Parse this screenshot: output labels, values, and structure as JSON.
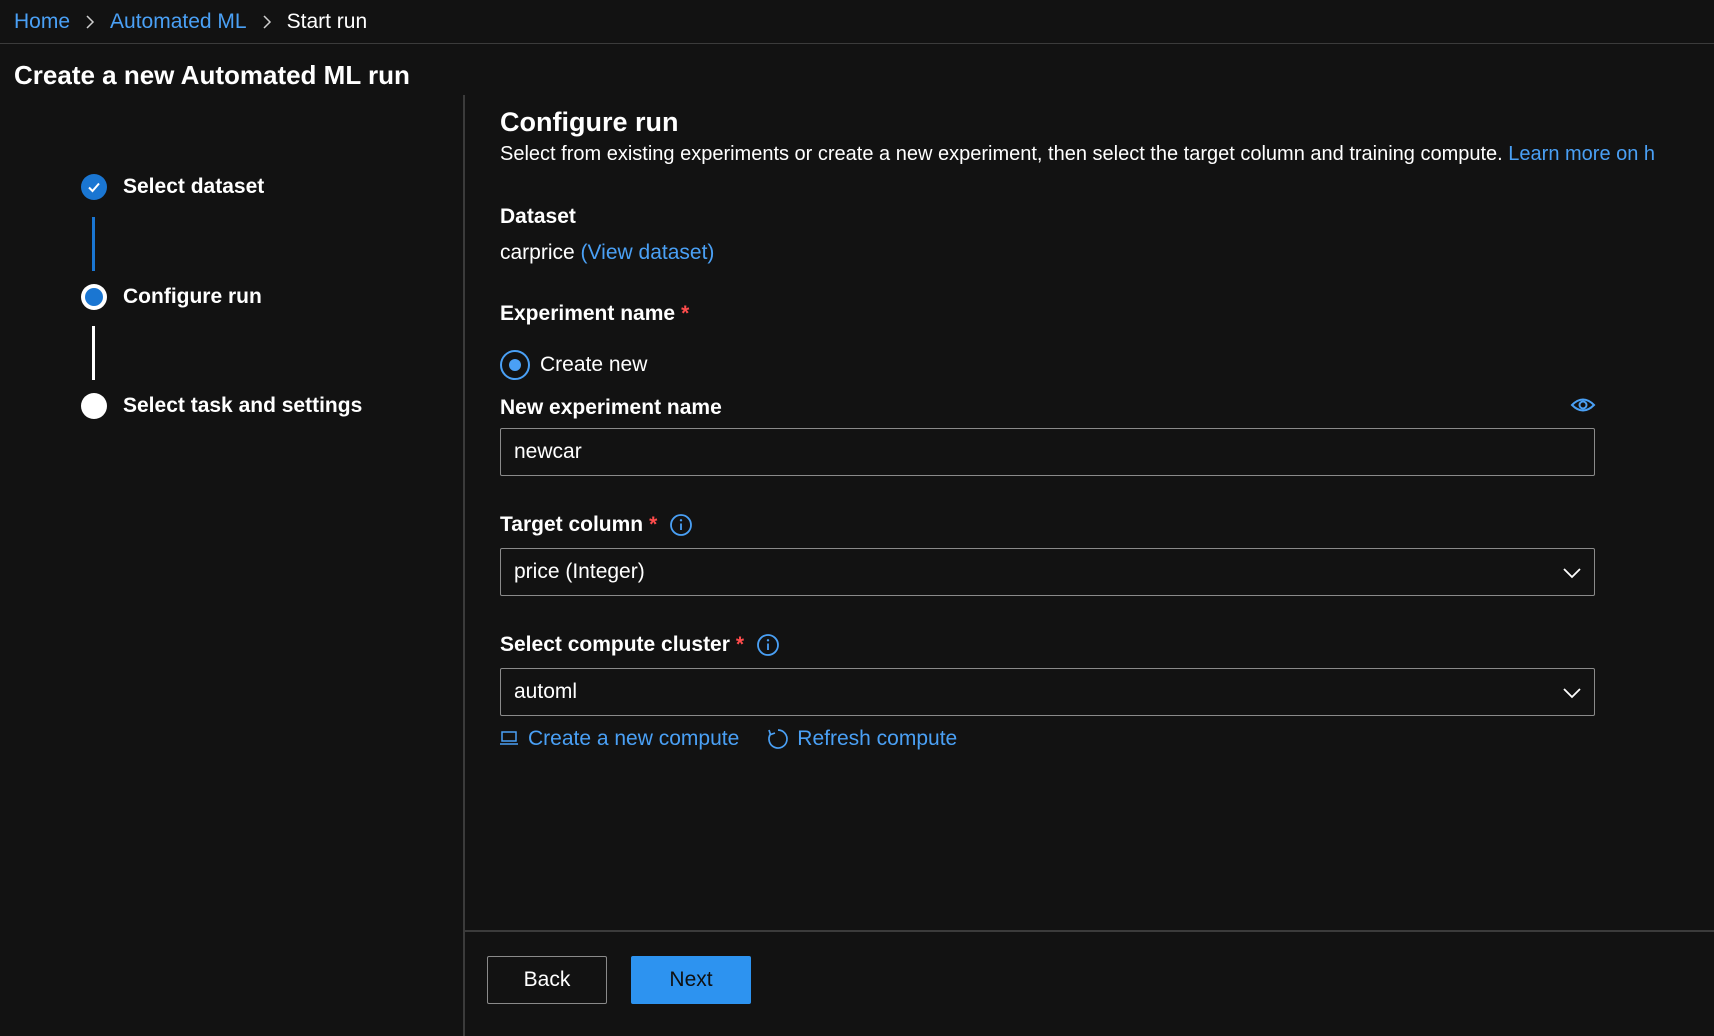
{
  "breadcrumb": {
    "items": [
      {
        "label": "Home"
      },
      {
        "label": "Automated ML"
      },
      {
        "label": "Start run"
      }
    ]
  },
  "page": {
    "title": "Create a new Automated ML run"
  },
  "wizard": {
    "steps": [
      {
        "label": "Select dataset",
        "status": "completed"
      },
      {
        "label": "Configure run",
        "status": "current"
      },
      {
        "label": "Select task and settings",
        "status": "pending"
      }
    ]
  },
  "main": {
    "title": "Configure run",
    "description": "Select from existing experiments or create a new experiment, then select the target column and training compute.",
    "learn_more_text": "Learn more on h",
    "dataset": {
      "label": "Dataset",
      "name": "carprice",
      "view_link": "(View dataset)"
    },
    "experiment": {
      "label": "Experiment name",
      "required_mark": "*",
      "radio_option": "Create new",
      "radio_selected": true,
      "new_name_label": "New experiment name",
      "new_name_value": "newcar"
    },
    "target_column": {
      "label": "Target column",
      "required_mark": "*",
      "selected": "price (Integer)"
    },
    "compute": {
      "label": "Select compute cluster",
      "required_mark": "*",
      "selected": "automl",
      "create_link": "Create a new compute",
      "refresh_link": "Refresh compute"
    }
  },
  "footer": {
    "back_label": "Back",
    "next_label": "Next"
  },
  "colors": {
    "background": "#121212",
    "accent": "#4aa0f5",
    "primary_button": "#2d93f0",
    "step_blue": "#1a76d2",
    "required": "#ff4c4c",
    "divider": "#3b3b3b"
  }
}
